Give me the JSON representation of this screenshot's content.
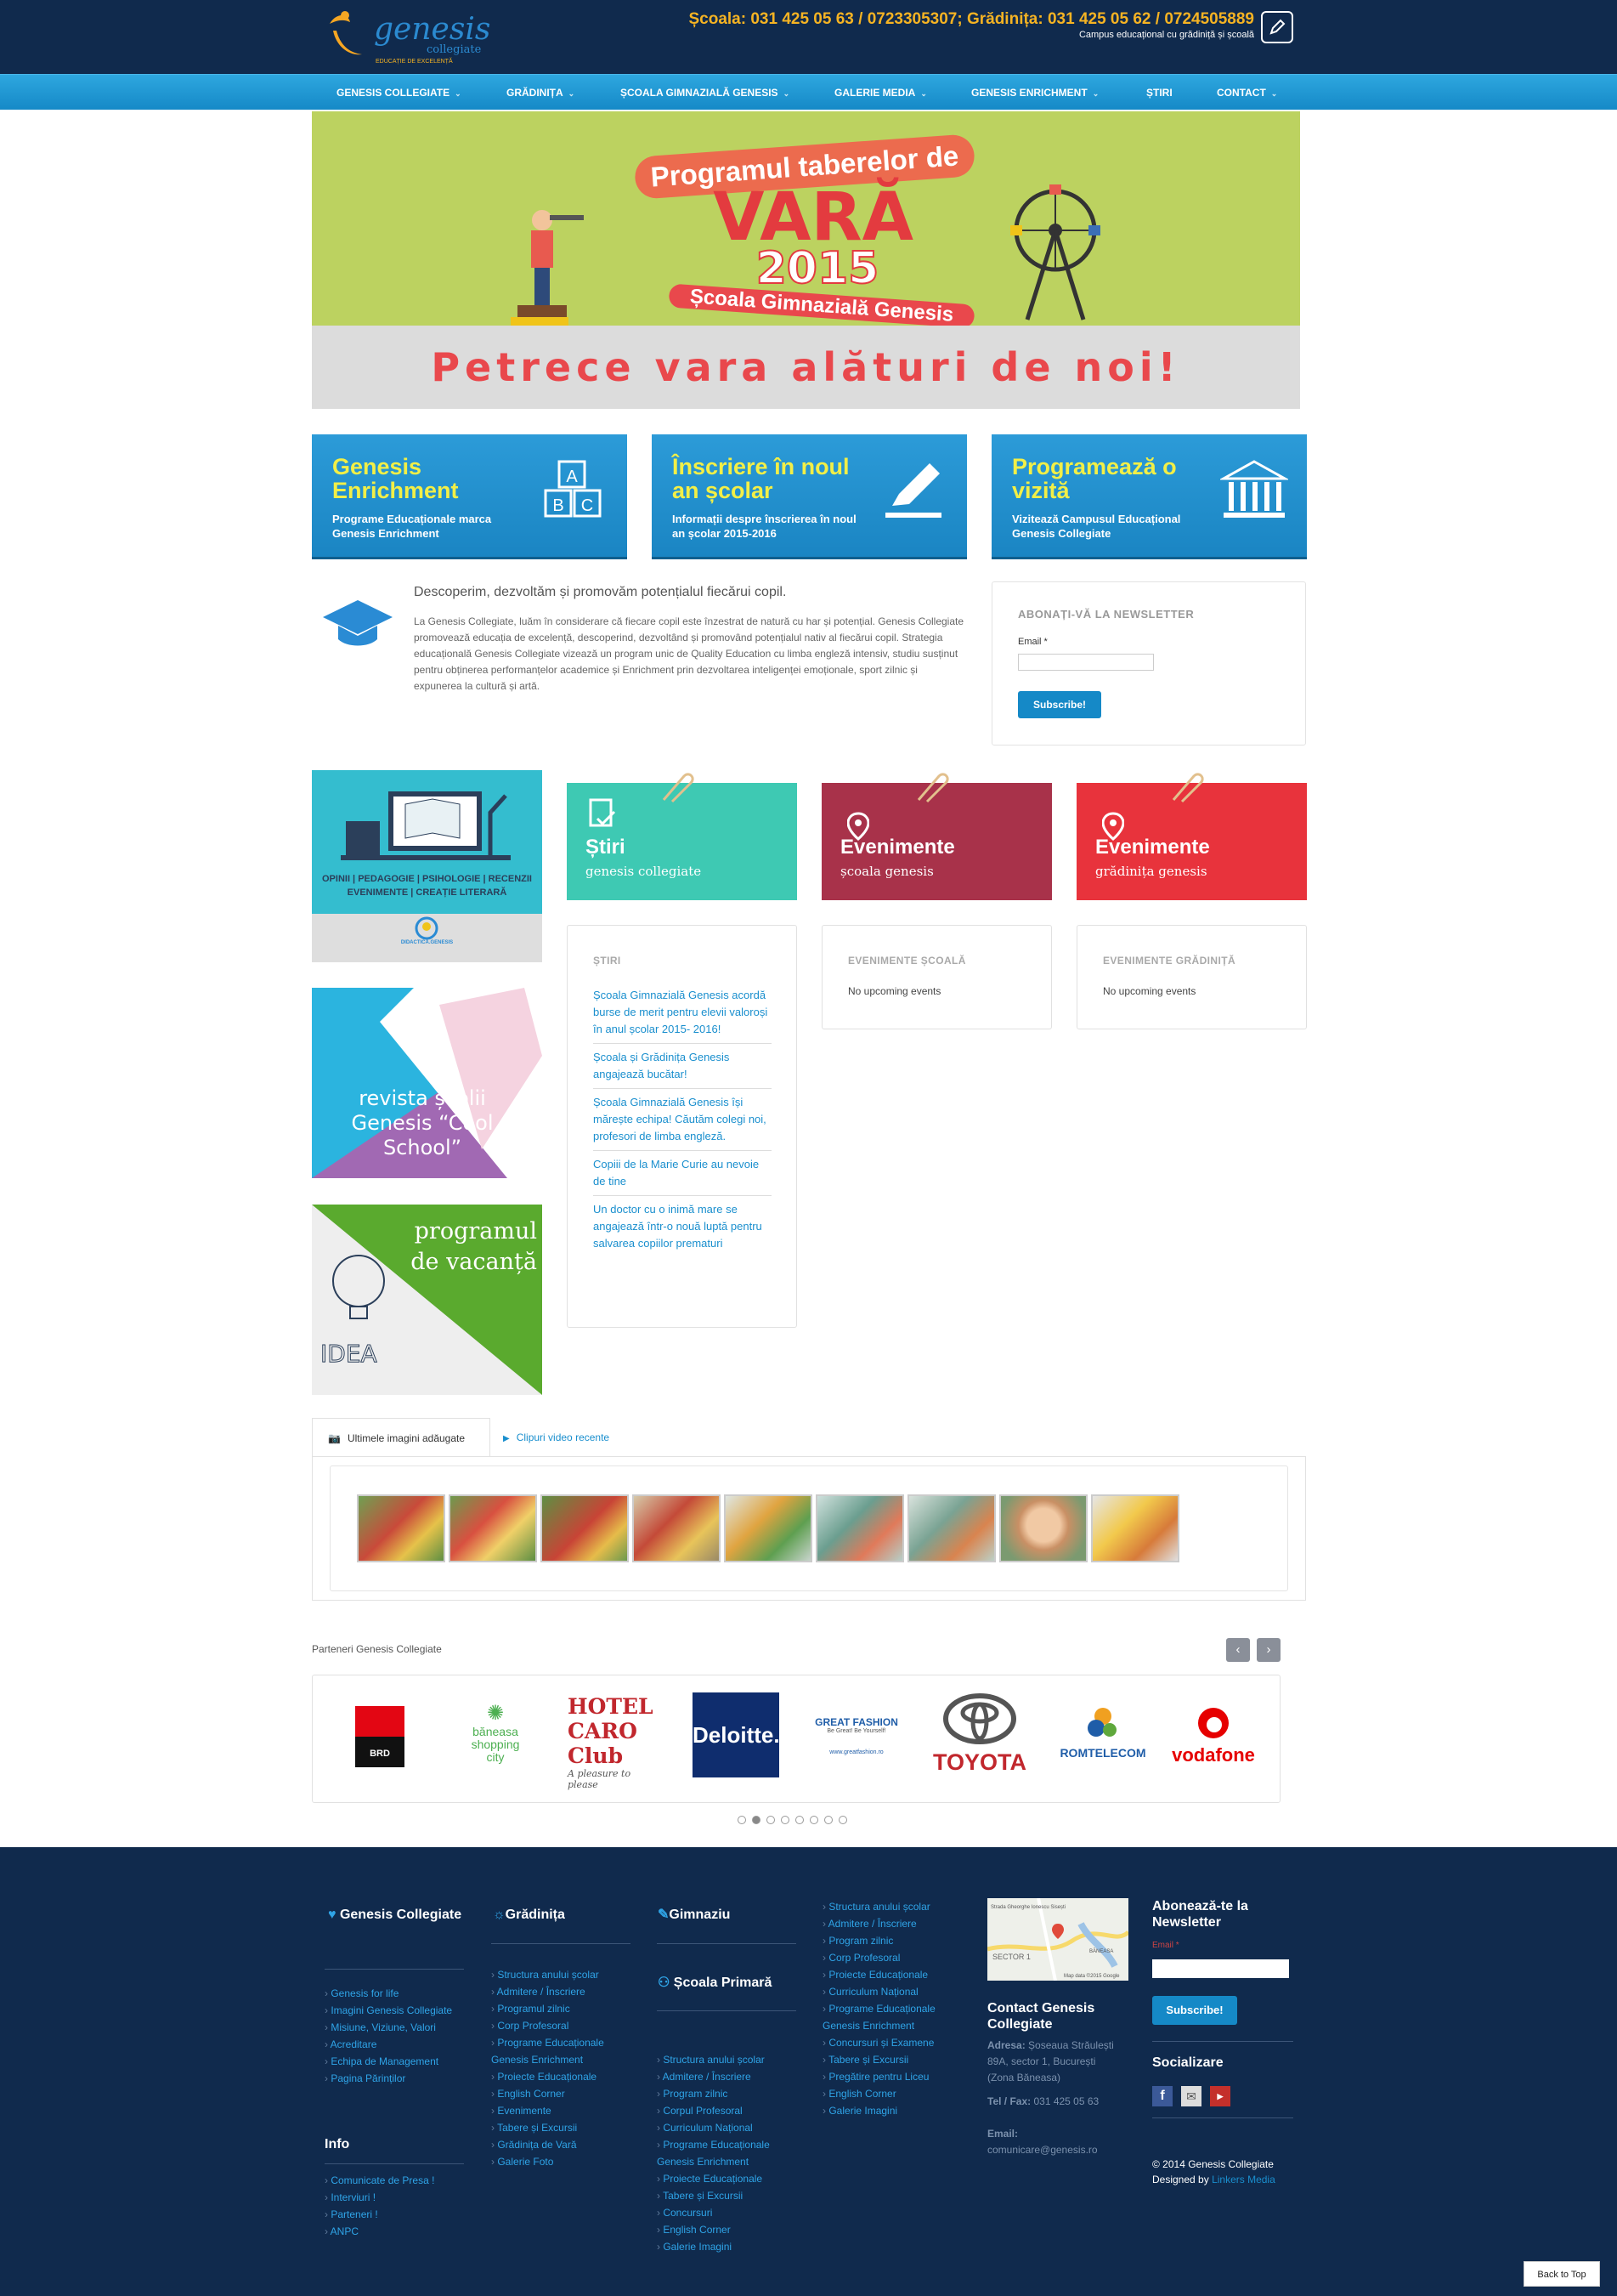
{
  "header": {
    "logo_text": "genesis",
    "logo_sub": "collegiate",
    "logo_tag": "EDUCAȚIE DE EXCELENȚĂ",
    "phones": "Școala: 031 425 05 63 / 0723305307; Grădinița: 031 425 05 62 / 0724505889",
    "tagline": "Campus educațional cu grădiniță și școală"
  },
  "nav": {
    "items": [
      {
        "label": "GENESIS COLLEGIATE",
        "dropdown": true
      },
      {
        "label": "GRĂDINIȚA",
        "dropdown": true
      },
      {
        "label": "ȘCOALA GIMNAZIALĂ GENESIS",
        "dropdown": true
      },
      {
        "label": "GALERIE MEDIA",
        "dropdown": true
      },
      {
        "label": "GENESIS ENRICHMENT",
        "dropdown": true
      },
      {
        "label": "ȘTIRI",
        "dropdown": false
      },
      {
        "label": "CONTACT",
        "dropdown": true
      }
    ]
  },
  "banner": {
    "line1": "Programul taberelor de",
    "line2": "VARĂ",
    "line3": "2015",
    "line4": "Școala Gimnazială Genesis",
    "bottom": "Petrece vara alături de noi!"
  },
  "features": [
    {
      "title": "Genesis Enrichment",
      "subtitle": "Programe Educaționale marca Genesis Enrichment",
      "icon": "abc-blocks-icon"
    },
    {
      "title": "Înscriere în noul an școlar",
      "subtitle": "Informații despre înscrierea în noul an școlar 2015-2016",
      "icon": "pencil-icon"
    },
    {
      "title": "Programează o vizită",
      "subtitle": "Vizitează Campusul Educațional Genesis Collegiate",
      "icon": "building-icon"
    }
  ],
  "intro": {
    "heading": "Descoperim, dezvoltăm și promovăm potențialul fiecărui copil.",
    "text": "La Genesis Collegiate, luăm în considerare că fiecare copil este înzestrat de natură cu har și potențial. Genesis Collegiate promovează educația de excelență, descoperind, dezvoltând și promovând potențialul nativ al fiecărui copil. Strategia educațională Genesis Collegiate vizează un program unic de Quality Education cu limba engleză intensiv, studiu susținut pentru obținerea performanțelor academice și Enrichment prin dezvoltarea inteligenței emoționale, sport zilnic și expunerea la cultură și artă."
  },
  "newsletter": {
    "title": "ABONAȚI-VĂ LA NEWSLETTER",
    "email_label": "Email *",
    "email_value": "",
    "button": "Subscribe!"
  },
  "tiles": {
    "didactica_line1": "OPINII | PEDAGOGIE | PSIHOLOGIE | RECENZII",
    "didactica_line2": "EVENIMENTE | CREAȚIE LITERARĂ",
    "didactica_logo": "DIDACTICA.GENESIS",
    "magazine": "revista școlii Genesis “Cool School”",
    "vacation": "programul de vacanță"
  },
  "categories": [
    {
      "title": "Știri",
      "subtitle": "genesis collegiate",
      "color": "#3ec9b3",
      "icon": "document-check-icon"
    },
    {
      "title": "Evenimente",
      "subtitle": "școala genesis",
      "color": "#a8324a",
      "icon": "map-pin-icon"
    },
    {
      "title": "Evenimente",
      "subtitle": "grădinița genesis",
      "color": "#e8333c",
      "icon": "map-pin-icon"
    }
  ],
  "news_panel": {
    "heading": "ȘTIRI",
    "items": [
      "Școala Gimnazială Genesis acordă burse de merit pentru elevii valoroși în anul școlar 2015- 2016!",
      "Școala și Grădinița Genesis angajează bucătar!",
      "Școala Gimnazială Genesis își mărește echipa! Căutăm colegi noi, profesori de limba engleză.",
      "Copiii de la Marie Curie au nevoie de tine",
      "Un doctor cu o inimă mare se angajează într-o nouă luptă pentru salvarea copiilor prematuri"
    ]
  },
  "school_events": {
    "heading": "EVENIMENTE ȘCOALĂ",
    "empty": "No upcoming events"
  },
  "kinder_events": {
    "heading": "EVENIMENTE GRĂDINIȚĂ",
    "empty": "No upcoming events"
  },
  "media": {
    "tab_images": "Ultimele imagini adăugate",
    "tab_videos": "Clipuri video recente",
    "thumb_count": 9
  },
  "partners": {
    "label": "Parteneri Genesis Collegiate",
    "logos": [
      "BRD",
      "băneasa shopping city",
      "HOTEL CARO Club",
      "Deloitte.",
      "GREAT FASHION",
      "TOYOTA",
      "ROMTELECOM",
      "vodafone"
    ],
    "caro_tagline": "A pleasure to please",
    "great_fashion_tagline": "Be Great! Be Yourself!",
    "great_fashion_url": "www.greatfashion.ro",
    "pages": 8,
    "active_page": 2
  },
  "footer": {
    "col1": {
      "title": "Genesis Collegiate",
      "links": [
        "Genesis for life",
        "Imagini Genesis Collegiate",
        "Misiune, Viziune, Valori",
        "Acreditare",
        "Echipa de Management",
        "Pagina Părinților"
      ],
      "info_title": "Info",
      "info_links": [
        "Comunicate de Presa !",
        "Interviuri !",
        "Parteneri !",
        "ANPC"
      ]
    },
    "col2": {
      "title": "Grădinița",
      "links": [
        "Structura anului școlar",
        "Admitere / Înscriere",
        "Programul zilnic",
        "Corp Profesoral",
        "Programe Educaționale Genesis Enrichment",
        "Proiecte Educaționale",
        "English Corner",
        "Evenimente",
        "Tabere și Excursii",
        "Grădinița de Vară",
        "Galerie Foto"
      ]
    },
    "col3": {
      "title": "Gimnaziu",
      "title2": "Școala Primară",
      "links": [
        "Structura anului școlar",
        "Admitere / Înscriere",
        "Program zilnic",
        "Corpul Profesoral",
        "Curriculum Național",
        "Programe Educaționale Genesis Enrichment",
        "Proiecte Educaționale",
        "Tabere și Excursii",
        "Concursuri",
        "English Corner",
        "Galerie Imagini"
      ]
    },
    "col4": {
      "links": [
        "Structura anului școlar",
        "Admitere / Înscriere",
        "Program zilnic",
        "Corp Profesoral",
        "Proiecte Educaționale",
        "Curriculum Național",
        "Programe Educaționale Genesis Enrichment",
        "Concursuri și Examene",
        "Tabere și Excursii",
        "Pregătire pentru Liceu",
        "English Corner",
        "Galerie Imagini"
      ]
    },
    "contact": {
      "title": "Contact Genesis Collegiate",
      "address_label": "Adresa:",
      "address": "Șoseaua Străulești 89A, sector 1, București (Zona Băneasa)",
      "tel_label": "Tel / Fax:",
      "tel": "031 425 05 63",
      "email_label": "Email:",
      "email": "comunicare@genesis.ro",
      "map_sector": "SECTOR 1",
      "map_road": "Strada Gheorghe Ionescu Sisești",
      "map_area": "BĂNEASA",
      "map_credit": "Map data ©2015 Google"
    },
    "subscribe": {
      "title": "Abonează-te la Newsletter",
      "email_label": "Email *",
      "button": "Subscribe!",
      "social_title": "Socializare",
      "copyright": "© 2014 Genesis Collegiate",
      "designed_by": "Designed by",
      "designer": "Linkers Media"
    },
    "back_to_top": "Back to Top"
  }
}
